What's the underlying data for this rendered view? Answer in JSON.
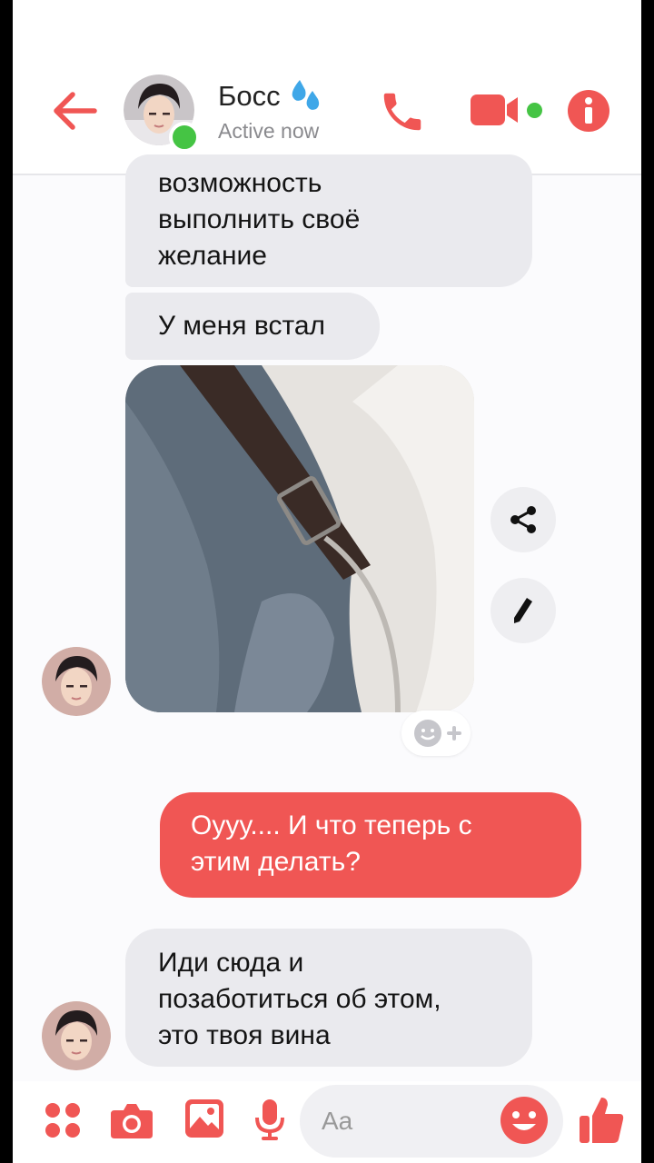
{
  "header": {
    "title": "Босс",
    "status": "Active now"
  },
  "messages": {
    "received_1": [
      "возможность",
      "выполнить своё",
      "желание"
    ],
    "received_2": "У меня встал",
    "sent_1": [
      "Оууу.... И что теперь с",
      "этим делать?"
    ],
    "received_3": [
      "Иди сюда и",
      "позаботиться об этом,",
      "это твоя вина"
    ]
  },
  "composer": {
    "placeholder": "Aa"
  },
  "colors": {
    "accent": "#f05654",
    "received_bubble": "#eaeaee",
    "online": "#45c444"
  },
  "icons": [
    "back-arrow-icon",
    "droplets-icon",
    "phone-icon",
    "video-camera-icon",
    "info-icon",
    "share-icon",
    "edit-pencil-icon",
    "add-reaction-icon",
    "apps-grid-icon",
    "camera-icon",
    "gallery-icon",
    "microphone-icon",
    "emoji-icon",
    "thumbs-up-icon"
  ]
}
